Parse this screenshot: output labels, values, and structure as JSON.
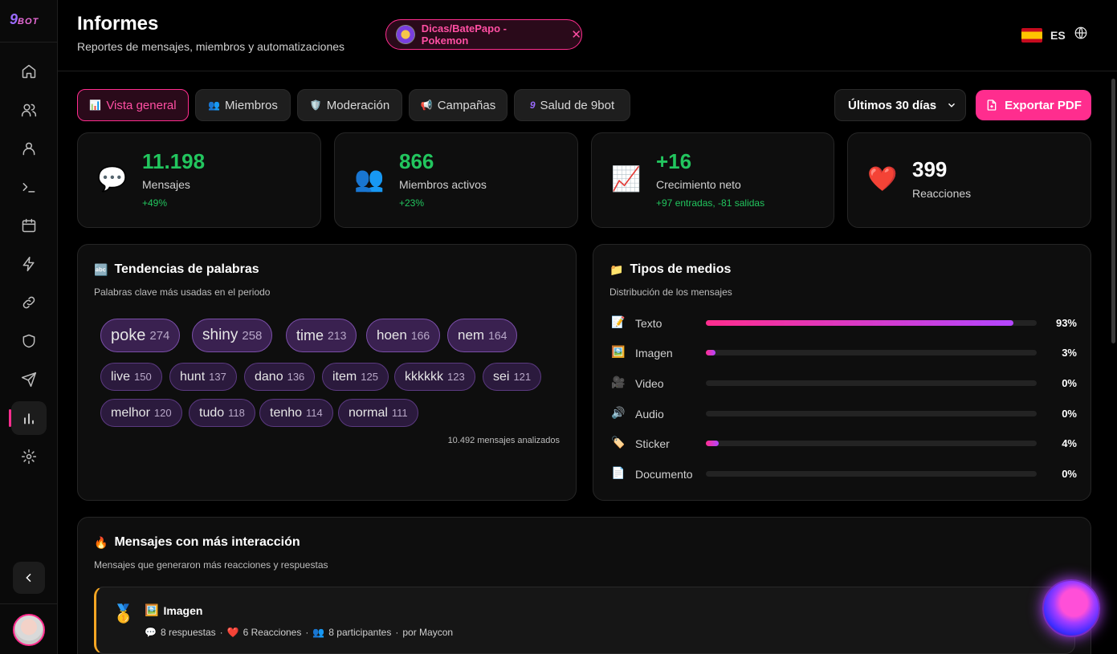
{
  "brand": {
    "name": "9BOT",
    "nine": "9",
    "bot": "BOT"
  },
  "header": {
    "title": "Informes",
    "subtitle": "Reportes de mensajes, miembros y automatizaciones",
    "group_chip": "Dicas/BatePapo - Pokemon",
    "lang_code": "ES"
  },
  "sidebar": {
    "items": [
      "home",
      "members",
      "user",
      "terminal",
      "calendar",
      "automations",
      "links",
      "moderation",
      "campaigns",
      "reports",
      "settings"
    ],
    "active": "reports"
  },
  "tabs": [
    {
      "icon": "📊",
      "label": "Vista general",
      "active": true
    },
    {
      "icon": "👥",
      "label": "Miembros",
      "active": false
    },
    {
      "icon": "🛡️",
      "label": "Moderación",
      "active": false
    },
    {
      "icon": "📢",
      "label": "Campañas",
      "active": false
    },
    {
      "icon": "9",
      "label": "Salud de 9bot",
      "active": false
    }
  ],
  "range": {
    "value": "Últimos 30 días"
  },
  "export": {
    "label": "Exportar PDF"
  },
  "stats": [
    {
      "icon": "💬",
      "value": "11.198",
      "label": "Mensajes",
      "delta": "+49%"
    },
    {
      "icon": "👥",
      "value": "866",
      "label": "Miembros activos",
      "delta": "+23%"
    },
    {
      "icon": "📈",
      "value": "+16",
      "label": "Crecimiento neto",
      "delta": "+97 entradas, -81 salidas"
    },
    {
      "icon": "❤️",
      "value": "399",
      "label": "Reacciones",
      "delta": ""
    }
  ],
  "word_trends": {
    "icon": "🔤",
    "title": "Tendencias de palabras",
    "subtitle": "Palabras clave más usadas en el periodo",
    "words": [
      {
        "word": "poke",
        "count": "274"
      },
      {
        "word": "shiny",
        "count": "258"
      },
      {
        "word": "time",
        "count": "213"
      },
      {
        "word": "hoen",
        "count": "166"
      },
      {
        "word": "nem",
        "count": "164"
      },
      {
        "word": "live",
        "count": "150"
      },
      {
        "word": "hunt",
        "count": "137"
      },
      {
        "word": "dano",
        "count": "136"
      },
      {
        "word": "item",
        "count": "125"
      },
      {
        "word": "kkkkkk",
        "count": "123"
      },
      {
        "word": "sei",
        "count": "121"
      },
      {
        "word": "melhor",
        "count": "120"
      },
      {
        "word": "tudo",
        "count": "118"
      },
      {
        "word": "tenho",
        "count": "114"
      },
      {
        "word": "normal",
        "count": "111"
      }
    ],
    "analyzed": "10.492 mensajes analizados"
  },
  "media_types": {
    "icon": "📁",
    "title": "Tipos de medios",
    "subtitle": "Distribución de los mensajes",
    "rows": [
      {
        "icon": "📝",
        "label": "Texto",
        "pct": "93%",
        "fraction": 0.93
      },
      {
        "icon": "🖼️",
        "label": "Imagen",
        "pct": "3%",
        "fraction": 0.03
      },
      {
        "icon": "🎥",
        "label": "Video",
        "pct": "0%",
        "fraction": 0
      },
      {
        "icon": "🔊",
        "label": "Audio",
        "pct": "0%",
        "fraction": 0
      },
      {
        "icon": "🏷️",
        "label": "Sticker",
        "pct": "4%",
        "fraction": 0.04
      },
      {
        "icon": "📄",
        "label": "Documento",
        "pct": "0%",
        "fraction": 0
      }
    ]
  },
  "top_messages": {
    "icon": "🔥",
    "title": "Mensajes con más interacción",
    "subtitle": "Mensajes que generaron más reacciones y respuestas",
    "items": [
      {
        "medal": "🥇",
        "type_icon": "🖼️",
        "type": "Imagen",
        "replies_icon": "💬",
        "replies": "8 respuestas",
        "reactions_icon": "❤️",
        "reactions": "6 Reacciones",
        "participants_icon": "👥",
        "participants": "8 participantes",
        "author": "por Maycon",
        "sep": "·"
      }
    ]
  },
  "colors": {
    "accent": "#ff2d8e",
    "positive": "#22c55e",
    "purple": "#b446ff"
  }
}
